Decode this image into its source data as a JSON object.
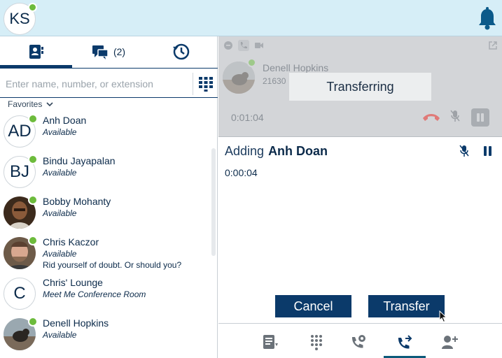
{
  "me": {
    "initials": "KS"
  },
  "tabs": [
    {
      "name": "contacts"
    },
    {
      "name": "messages",
      "count": "(2)"
    },
    {
      "name": "history"
    }
  ],
  "search": {
    "placeholder": "Enter name, number, or extension"
  },
  "favorites": {
    "label": "Favorites"
  },
  "contacts": [
    {
      "name": "Anh Doan",
      "status": "Available",
      "initials": "AD",
      "presence": "phone"
    },
    {
      "name": "Bindu Jayapalan",
      "status": "Available",
      "initials": "BJ",
      "presence": "person"
    },
    {
      "name": "Bobby Mohanty",
      "status": "Available",
      "initials": "",
      "presence": "person"
    },
    {
      "name": "Chris Kaczor",
      "status": "Available",
      "note": "Rid yourself of doubt. Or should you?",
      "initials": "",
      "presence": "person"
    },
    {
      "name": "Chris' Lounge",
      "status": "Meet Me Conference Room",
      "initials": "C",
      "presence": "none"
    },
    {
      "name": "Denell Hopkins",
      "status": "Available",
      "initials": "",
      "presence": "phone"
    }
  ],
  "held_call": {
    "name": "Denell Hopkins",
    "number": "21630",
    "timer": "0:01:04",
    "banner": "Transferring"
  },
  "adding_call": {
    "label": "Adding",
    "name": "Anh Doan",
    "timer": "0:00:04"
  },
  "buttons": {
    "cancel": "Cancel",
    "transfer": "Transfer"
  },
  "colors": {
    "primary": "#0b3a6a",
    "presence": "#6dbb3c",
    "topbar": "#d6eef7",
    "hangup": "#e06060"
  }
}
